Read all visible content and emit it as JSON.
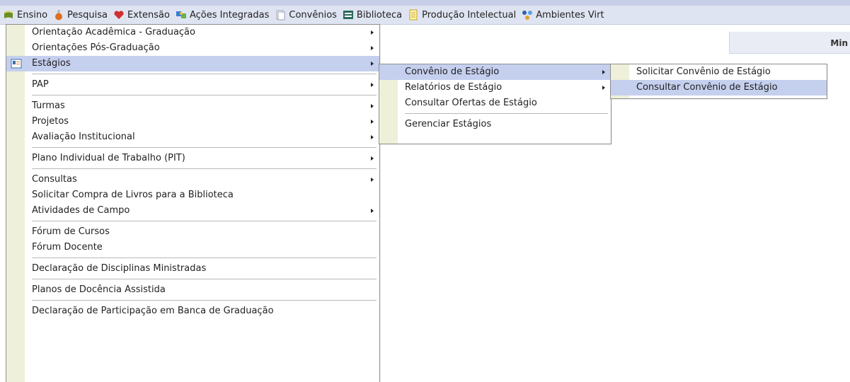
{
  "menubar": {
    "items": [
      {
        "label": "Ensino",
        "icon": "book-icon",
        "color": "#6b8e23"
      },
      {
        "label": "Pesquisa",
        "icon": "flask-icon",
        "color": "#e07020"
      },
      {
        "label": "Extensão",
        "icon": "heart-icon",
        "color": "#d03030"
      },
      {
        "label": "Ações Integradas",
        "icon": "puzzle-icon",
        "color": "#3a7fd0"
      },
      {
        "label": "Convênios",
        "icon": "document-icon",
        "color": "#9aa0b0"
      },
      {
        "label": "Biblioteca",
        "icon": "library-icon",
        "color": "#2a6a5a"
      },
      {
        "label": "Produção Intelectual",
        "icon": "notepad-icon",
        "color": "#c8a020"
      },
      {
        "label": "Ambientes Virt",
        "icon": "network-icon",
        "color": "#3060b0"
      }
    ]
  },
  "right_panel": {
    "label": "Min"
  },
  "menu_ensino": {
    "items": [
      {
        "type": "item",
        "label": "Orientação Acadêmica - Graduação",
        "submenu": true
      },
      {
        "type": "item",
        "label": "Orientações Pós-Graduação",
        "submenu": true
      },
      {
        "type": "item",
        "label": "Estágios",
        "submenu": true,
        "highlighted": true,
        "icon": "internship-icon"
      },
      {
        "type": "separator"
      },
      {
        "type": "item",
        "label": "PAP",
        "submenu": true
      },
      {
        "type": "separator"
      },
      {
        "type": "item",
        "label": "Turmas",
        "submenu": true
      },
      {
        "type": "item",
        "label": "Projetos",
        "submenu": true
      },
      {
        "type": "item",
        "label": "Avaliação Institucional",
        "submenu": true
      },
      {
        "type": "separator"
      },
      {
        "type": "item",
        "label": "Plano Individual de Trabalho (PIT)",
        "submenu": true
      },
      {
        "type": "separator"
      },
      {
        "type": "item",
        "label": "Consultas",
        "submenu": true
      },
      {
        "type": "item",
        "label": "Solicitar Compra de Livros para a Biblioteca",
        "submenu": false
      },
      {
        "type": "item",
        "label": "Atividades de Campo",
        "submenu": true
      },
      {
        "type": "separator"
      },
      {
        "type": "item",
        "label": "Fórum de Cursos",
        "submenu": false
      },
      {
        "type": "item",
        "label": "Fórum Docente",
        "submenu": false
      },
      {
        "type": "separator"
      },
      {
        "type": "item",
        "label": "Declaração de Disciplinas Ministradas",
        "submenu": false
      },
      {
        "type": "separator"
      },
      {
        "type": "item",
        "label": "Planos de Docência Assistida",
        "submenu": false
      },
      {
        "type": "separator"
      },
      {
        "type": "item",
        "label": "Declaração de Participação em Banca de Graduação",
        "submenu": false
      }
    ]
  },
  "menu_estagios": {
    "items": [
      {
        "type": "item",
        "label": "Convênio de Estágio",
        "submenu": true,
        "highlighted": true
      },
      {
        "type": "item",
        "label": "Relatórios de Estágio",
        "submenu": true
      },
      {
        "type": "item",
        "label": "Consultar Ofertas de Estágio",
        "submenu": false
      },
      {
        "type": "separator"
      },
      {
        "type": "item",
        "label": "Gerenciar Estágios",
        "submenu": false
      }
    ]
  },
  "menu_convenio": {
    "items": [
      {
        "type": "item",
        "label": "Solicitar Convênio de Estágio",
        "submenu": false
      },
      {
        "type": "item",
        "label": "Consultar Convênio de Estágio",
        "submenu": false,
        "highlighted": true
      }
    ]
  },
  "colors": {
    "highlight": "#c5cfee",
    "gutter": "#eef0d9",
    "menubar": "#dfe4f2"
  }
}
